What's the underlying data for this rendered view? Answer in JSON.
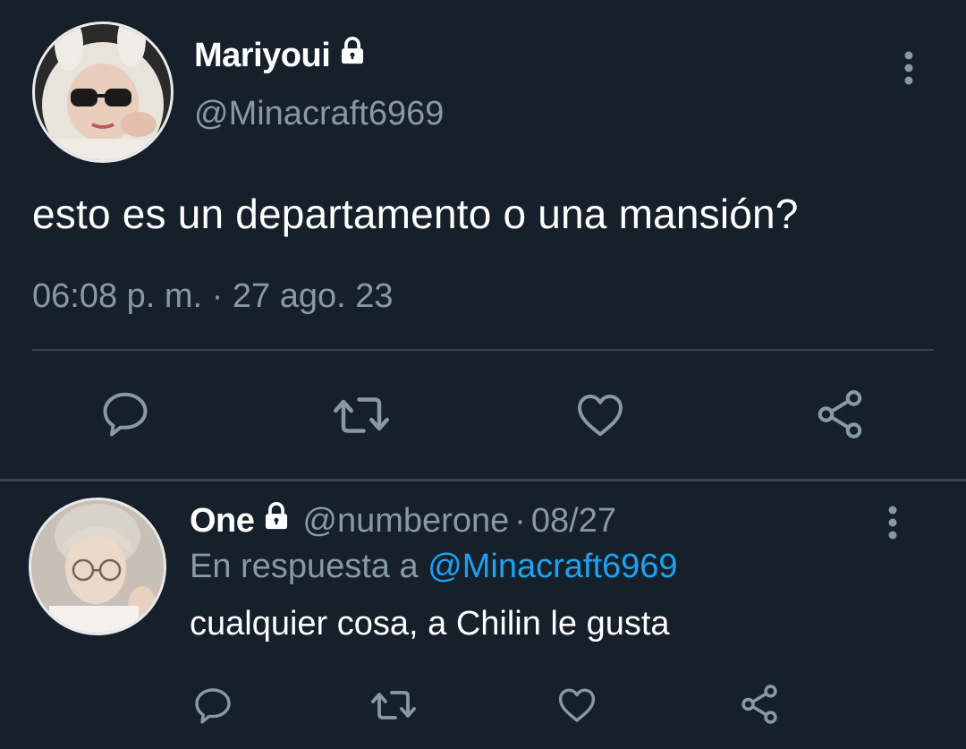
{
  "main_tweet": {
    "author": {
      "name": "Mariyoui",
      "handle": "@Minacraft6969",
      "protected": true
    },
    "text": "esto es un departamento o una mansión?",
    "time": "06:08 p. m.",
    "date": "27 ago. 23",
    "actions": [
      "comment-icon",
      "retweet-icon",
      "like-icon",
      "share-icon"
    ]
  },
  "reply": {
    "author": {
      "name": "One",
      "handle": "@numberone",
      "protected": true
    },
    "date": "08/27",
    "reply_to_prefix": "En respuesta a",
    "reply_to_handle": "@Minacraft6969",
    "text": "cualquier cosa, a Chilin le gusta",
    "actions": [
      "comment-icon",
      "retweet-icon",
      "like-icon",
      "share-icon"
    ]
  },
  "colors": {
    "background": "#15202b",
    "secondary_text": "#8899a6",
    "link": "#1da1f2",
    "divider": "#38444d"
  }
}
